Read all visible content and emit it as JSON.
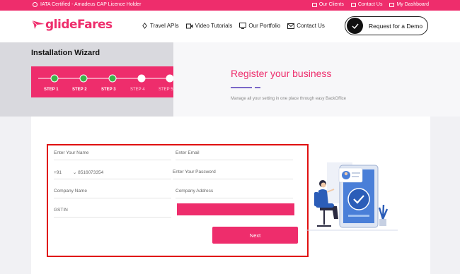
{
  "topbar": {
    "certified": "IATA Certified - Amadeus CAP Licence Holder",
    "our_clients": "Our Clients",
    "contact_us": "Contact Us",
    "my_dashboard": "My Dashboard"
  },
  "nav": {
    "logo": "glideFares",
    "items": [
      "Travel APIs",
      "Video Tutorials",
      "Our Portfolio",
      "Contact Us"
    ],
    "demo_label": "Request for a Demo"
  },
  "wizard": {
    "title": "Installation Wizard",
    "steps": [
      "STEP 1",
      "STEP 2",
      "STEP 3",
      "STEP 4",
      "STEP 5"
    ],
    "completed_steps": 3
  },
  "register": {
    "title": "Register your business",
    "subtitle": "Manage all your setting in one place through easy BackOffice"
  },
  "form": {
    "name_placeholder": "Enter Your Name",
    "email_placeholder": "Enter Email",
    "country_code": "+91",
    "phone_value": "8516073354",
    "password_placeholder": "Enter Your Password",
    "company_name_placeholder": "Company Name",
    "company_address_placeholder": "Company Address",
    "gstin_placeholder": "GSTIN",
    "next_label": "Next"
  },
  "colors": {
    "brand": "#ee2d6c",
    "accent": "#7a67c8",
    "highlight_border": "#e01010"
  }
}
